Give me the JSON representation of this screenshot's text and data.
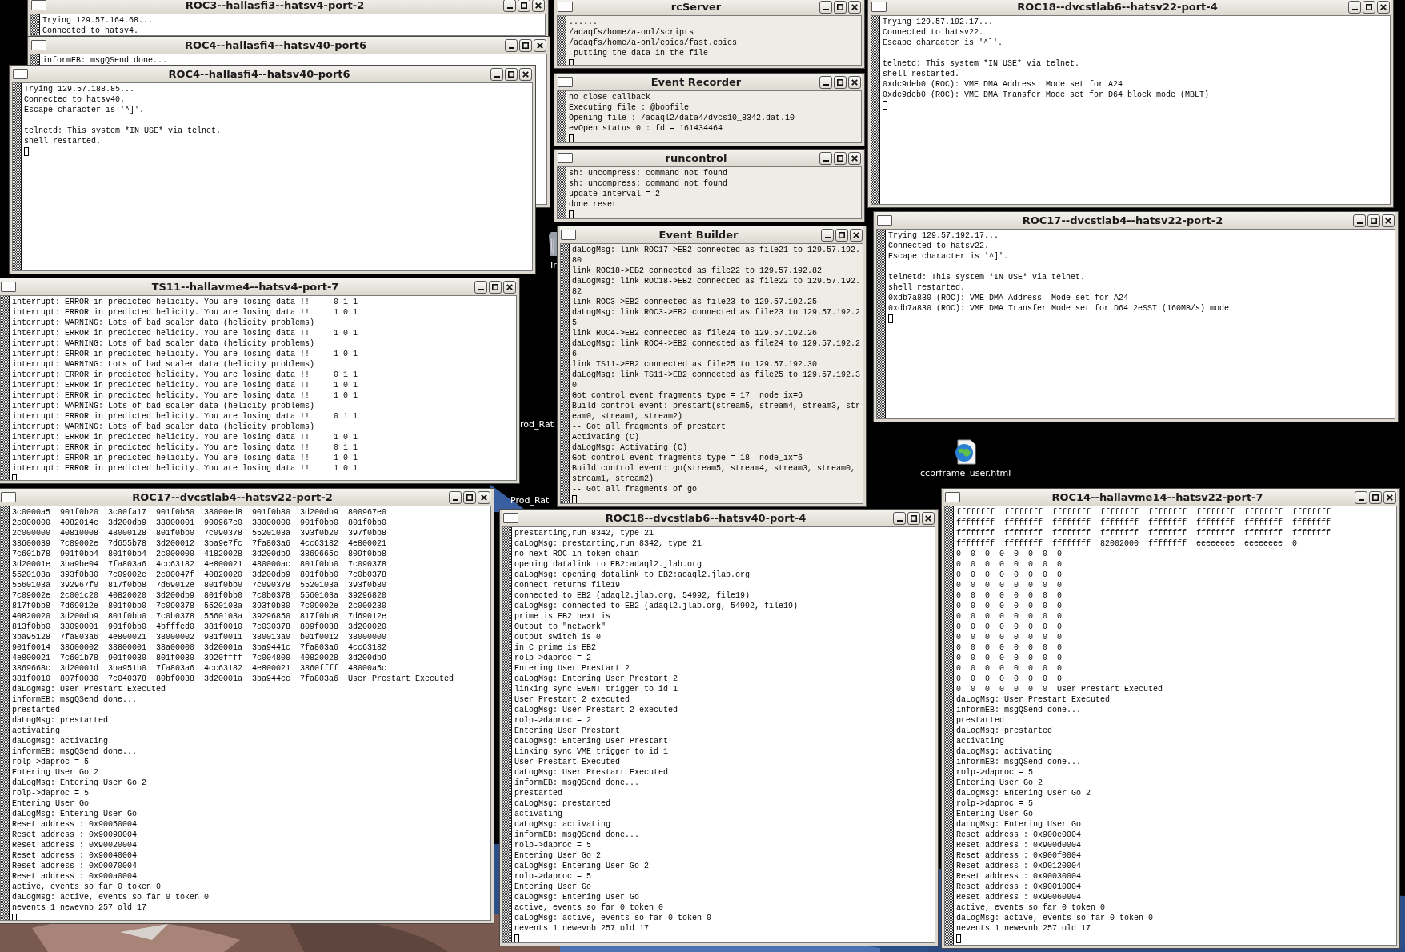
{
  "desktop_icons": [
    {
      "kind": "trash",
      "label": "Tr"
    },
    {
      "kind": "hidden",
      "label": "rod_Rat"
    },
    {
      "kind": "hidden",
      "label": "Prod_Rat"
    },
    {
      "kind": "html",
      "label": "ccprframe_user.html"
    }
  ],
  "windows": [
    {
      "title": "ROC3--hallasfi3--hatsv4-port-2",
      "kind": "terminal",
      "lines": [
        "Trying 129.57.164.68...",
        "Connected to hatsv4."
      ]
    },
    {
      "title": "ROC4--hallasfi4--hatsv40-port6",
      "kind": "terminal",
      "lines": [
        "informEB: msgQSend done..."
      ]
    },
    {
      "title": "ROC4--hallasfi4--hatsv40-port6",
      "kind": "terminal",
      "paragraphs": [
        [
          "Trying 129.57.188.85...",
          "Connected to hatsv40.",
          "Escape character is '^]'."
        ],
        [
          "telnetd: This system *IN USE* via telnet.",
          "shell restarted."
        ]
      ]
    },
    {
      "title": "TS11--hallavme4--hatsv4-port-7",
      "kind": "terminal",
      "lines": [
        "interrupt: ERROR in predicted helicity. You are losing data !!     0 1 1",
        "interrupt: ERROR in predicted helicity. You are losing data !!     1 0 1",
        "interrupt: WARNING: Lots of bad scaler data (helicity problems)",
        "interrupt: ERROR in predicted helicity. You are losing data !!     1 0 1",
        "interrupt: WARNING: Lots of bad scaler data (helicity problems)",
        "interrupt: ERROR in predicted helicity. You are losing data !!     1 0 1",
        "interrupt: WARNING: Lots of bad scaler data (helicity problems)",
        "interrupt: ERROR in predicted helicity. You are losing data !!     0 1 1",
        "interrupt: ERROR in predicted helicity. You are losing data !!     1 0 1",
        "interrupt: ERROR in predicted helicity. You are losing data !!     1 0 1",
        "interrupt: WARNING: Lots of bad scaler data (helicity problems)",
        "interrupt: ERROR in predicted helicity. You are losing data !!     0 1 1",
        "interrupt: WARNING: Lots of bad scaler data (helicity problems)",
        "interrupt: ERROR in predicted helicity. You are losing data !!     1 0 1",
        "interrupt: ERROR in predicted helicity. You are losing data !!     0 1 1",
        "interrupt: ERROR in predicted helicity. You are losing data !!     1 0 1",
        "interrupt: ERROR in predicted helicity. You are losing data !!     1 0 1"
      ]
    },
    {
      "title": "ROC17--dvcstlab4--hatsv22-port-2",
      "kind": "terminal",
      "lines": [
        "3c0000a5  901f0b20  3c00fa17  901f0b50  38000ed8  901f0b80  3d200db9  800967e0",
        "2c000000  4082014c  3d200db9  38000001  900967e0  38000000  901f0bb0  801f0bb0",
        "2c000000  40810008  48000128  801f0bb0  7c090378  5520103a  393f0b20  397f0bb8",
        "38600039  7c89002e  7d655b78  3d200012  3ba9e7fc  7fa803a6  4cc63182  4e800021",
        "7c601b78  901f0bb4  801f0bb4  2c000000  41820028  3d200db9  3869665c  809f0bb8",
        "3d20001e  3ba9be04  7fa803a6  4cc63182  4e800021  480000ac  801f0bb0  7c090378",
        "5520103a  393f0b80  7c09002e  2c00047f  40820020  3d200db9  801f0bb0  7c0b0378",
        "5560103a  392967f0  817f0bb8  7d69012e  801f0bb0  7c090378  5520103a  393f0b80",
        "7c09002e  2c001c20  40820020  3d200db9  801f0bb0  7c0b0378  5560103a  39296820",
        "817f0bb8  7d69012e  801f0bb0  7c090378  5520103a  393f0b80  7c09002e  2c000230",
        "40820020  3d200db9  801f0bb0  7c0b0378  5560103a  39296850  817f0bb8  7d69012e",
        "813f0bb0  38090001  901f0bb0  4bfffed0  381f0010  7c030378  809f0038  3d200020",
        "3ba95128  7fa803a6  4e800021  38000002  981f0011  380013a0  b01f0012  38000000",
        "901f0014  38600002  38800001  38a00000  3d20001a  3ba9441c  7fa803a6  4cc63182",
        "4e800021  7c601b78  901f0030  801f0030  3920ffff  7c004800  40820028  3d200db9",
        "3869668c  3d20001d  3ba951b0  7fa803a6  4cc63182  4e800021  3860ffff  48000a5c",
        "381f0010  807f0030  7c040378  80bf0038  3d20001a  3ba944cc  7fa803a6  User Prestart Executed",
        "daLogMsg: User Prestart Executed",
        "informEB: msgQSend done...",
        "prestarted",
        "daLogMsg: prestarted",
        "activating",
        "daLogMsg: activating",
        "informEB: msgQSend done...",
        "rolp->daproc = 5",
        "Entering User Go 2",
        "daLogMsg: Entering User Go 2",
        "rolp->daproc = 5",
        "Entering User Go",
        "daLogMsg: Entering User Go",
        "Reset address : 0x90050004",
        "Reset address : 0x90090004",
        "Reset address : 0x90020004",
        "Reset address : 0x90040004",
        "Reset address : 0x90070004",
        "Reset address : 0x900a0004",
        "active, events so far 0 token 0",
        "daLogMsg: active, events so far 0 token 0",
        "nevents 1 newevnb 257 old 17"
      ]
    },
    {
      "title": "rcServer",
      "kind": "console",
      "lines": [
        "......",
        "/adaqfs/home/a-onl/scripts",
        "/adaqfs/home/a-onl/epics/fast.epics",
        " putting the data in the file"
      ]
    },
    {
      "title": "Event Recorder",
      "kind": "console",
      "lines": [
        "no close callback",
        "Executing file : @bobfile",
        "Opening file : /adaql2/data4/dvcs10_8342.dat.10",
        "evOpen status 0 : fd = 161434464"
      ]
    },
    {
      "title": "runcontrol",
      "kind": "console",
      "lines": [
        "sh: uncompress: command not found",
        "sh: uncompress: command not found",
        "update interval = 2",
        "done reset"
      ]
    },
    {
      "title": "Event Builder",
      "kind": "console",
      "lines": [
        "daLogMsg: link ROC17->EB2 connected as file21 to 129.57.192.",
        "80",
        "link ROC18->EB2 connected as file22 to 129.57.192.82",
        "daLogMsg: link ROC18->EB2 connected as file22 to 129.57.192.",
        "82",
        "link ROC3->EB2 connected as file23 to 129.57.192.25",
        "daLogMsg: link ROC3->EB2 connected as file23 to 129.57.192.2",
        "5",
        "link ROC4->EB2 connected as file24 to 129.57.192.26",
        "daLogMsg: link ROC4->EB2 connected as file24 to 129.57.192.2",
        "6",
        "link TS11->EB2 connected as file25 to 129.57.192.30",
        "daLogMsg: link TS11->EB2 connected as file25 to 129.57.192.3",
        "0",
        "Got control event fragments type = 17  node_ix=6",
        "Build control event: prestart(stream5, stream4, stream3, str",
        "eam0, stream1, stream2)",
        "-- Got all fragments of prestart",
        "Activating (C)",
        "daLogMsg: Activating (C)",
        "Got control event fragments type = 18  node_ix=6",
        "Build control event: go(stream5, stream4, stream3, stream0,",
        "stream1, stream2)",
        "-- Got all fragments of go"
      ]
    },
    {
      "title": "ROC18--dvcstlab6--hatsv22-port-4",
      "kind": "terminal",
      "paragraphs": [
        [
          "Trying 129.57.192.17...",
          "Connected to hatsv22.",
          "Escape character is '^]'."
        ],
        [
          "telnetd: This system *IN USE* via telnet.",
          "shell restarted.",
          "0xdc9deb0 (ROC): VME DMA Address  Mode set for A24",
          "0xdc9deb0 (ROC): VME DMA Transfer Mode set for D64 block mode (MBLT)"
        ]
      ]
    },
    {
      "title": "ROC17--dvcstlab4--hatsv22-port-2",
      "kind": "terminal",
      "paragraphs": [
        [
          "Trying 129.57.192.17...",
          "Connected to hatsv22.",
          "Escape character is '^]'."
        ],
        [
          "telnetd: This system *IN USE* via telnet.",
          "shell restarted.",
          "0xdb7a830 (ROC): VME DMA Address  Mode set for A24",
          "0xdb7a830 (ROC): VME DMA Transfer Mode set for D64 2eSST (160MB/s) mode"
        ]
      ]
    },
    {
      "title": "ROC18--dvcstlab6--hatsv40-port-4",
      "kind": "terminal",
      "lines": [
        "prestarting,run 8342, type 21",
        "daLogMsg: prestarting,run 8342, type 21",
        "no next ROC in token chain",
        "opening datalink to EB2:adaql2.jlab.org",
        "daLogMsg: opening datalink to EB2:adaql2.jlab.org",
        "connect returns file19",
        "connected to EB2 (adaql2.jlab.org, 54992, file19)",
        "daLogMsg: connected to EB2 (adaql2.jlab.org, 54992, file19)",
        "prime is EB2 next is",
        "Output to \"network\"",
        "output switch is 0",
        "in C prime is EB2",
        "rolp->daproc = 2",
        "Entering User Prestart 2",
        "daLogMsg: Entering User Prestart 2",
        "linking sync EVENT trigger to id 1",
        "User Prestart 2 executed",
        "daLogMsg: User Prestart 2 executed",
        "rolp->daproc = 2",
        "Entering User Prestart",
        "daLogMsg: Entering User Prestart",
        "Linking sync VME trigger to id 1",
        "User Prestart Executed",
        "daLogMsg: User Prestart Executed",
        "informEB: msgQSend done...",
        "prestarted",
        "daLogMsg: prestarted",
        "activating",
        "daLogMsg: activating",
        "informEB: msgQSend done...",
        "rolp->daproc = 5",
        "Entering User Go 2",
        "daLogMsg: Entering User Go 2",
        "rolp->daproc = 5",
        "Entering User Go",
        "daLogMsg: Entering User Go",
        "active, events so far 0 token 0",
        "daLogMsg: active, events so far 0 token 0",
        "nevents 1 newevnb 257 old 17"
      ]
    },
    {
      "title": "ROC14--hallavme14--hatsv22-port-7",
      "kind": "terminal",
      "lines": [
        "ffffffff  ffffffff  ffffffff  ffffffff  ffffffff  ffffffff  ffffffff  ffffffff",
        "ffffffff  ffffffff  ffffffff  ffffffff  ffffffff  ffffffff  ffffffff  ffffffff",
        "ffffffff  ffffffff  ffffffff  ffffffff  ffffffff  ffffffff  ffffffff  ffffffff",
        "ffffffff  ffffffff  ffffffff  82002000  ffffffff  eeeeeeee  eeeeeeee  0",
        "0  0  0  0  0  0  0  0",
        "0  0  0  0  0  0  0  0",
        "0  0  0  0  0  0  0  0",
        "0  0  0  0  0  0  0  0",
        "0  0  0  0  0  0  0  0",
        "0  0  0  0  0  0  0  0",
        "0  0  0  0  0  0  0  0",
        "0  0  0  0  0  0  0  0",
        "0  0  0  0  0  0  0  0",
        "0  0  0  0  0  0  0  0",
        "0  0  0  0  0  0  0  0",
        "0  0  0  0  0  0  0  0",
        "0  0  0  0  0  0  0  0",
        "0  0  0  0  0  0  0  User Prestart Executed",
        "daLogMsg: User Prestart Executed",
        "informEB: msgQSend done...",
        "prestarted",
        "daLogMsg: prestarted",
        "activating",
        "daLogMsg: activating",
        "informEB: msgQSend done...",
        "rolp->daproc = 5",
        "Entering User Go 2",
        "daLogMsg: Entering User Go 2",
        "rolp->daproc = 5",
        "Entering User Go",
        "daLogMsg: Entering User Go",
        "Reset address : 0x900e0004",
        "Reset address : 0x900d0004",
        "Reset address : 0x900f0004",
        "Reset address : 0x90120004",
        "Reset address : 0x90030004",
        "Reset address : 0x90010004",
        "Reset address : 0x90060004",
        "active, events so far 0 token 0",
        "daLogMsg: active, events so far 0 token 0",
        "nevents 1 newevnb 257 old 17"
      ]
    }
  ]
}
